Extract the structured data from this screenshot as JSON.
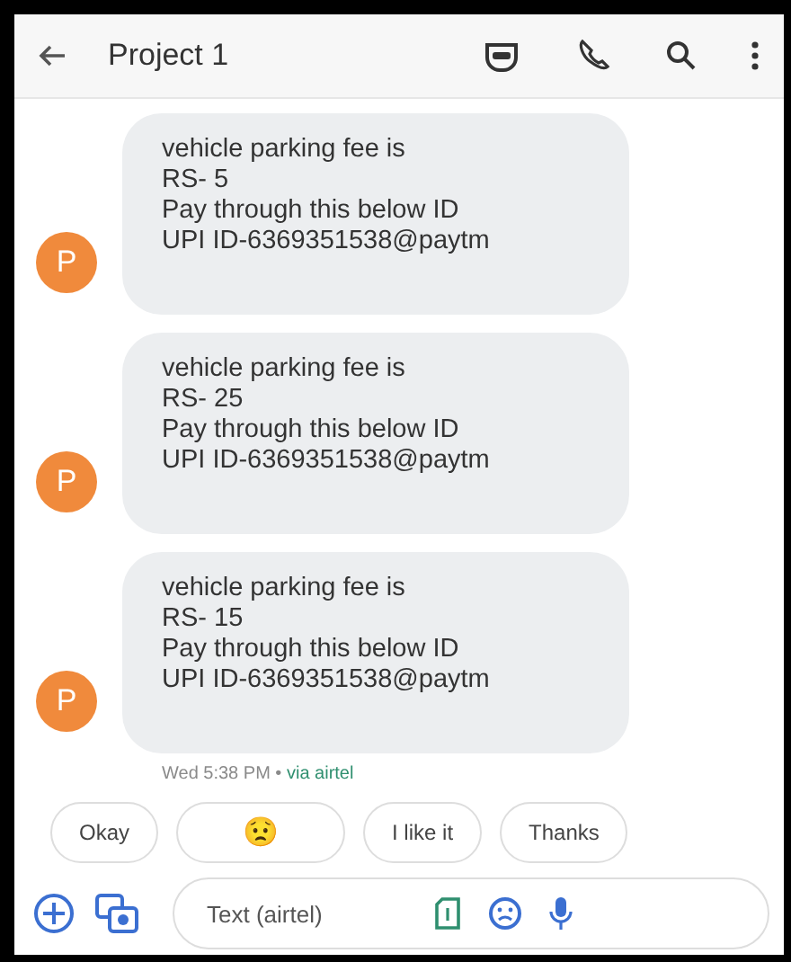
{
  "header": {
    "title": "Project 1"
  },
  "messages": [
    {
      "avatar": "P",
      "text": "vehicle parking fee is\nRS- 5\nPay through this below ID\nUPI ID-6369351538@paytm"
    },
    {
      "avatar": "P",
      "text": "vehicle parking fee is\nRS- 25\nPay through this below ID\nUPI ID-6369351538@paytm"
    },
    {
      "avatar": "P",
      "text": "vehicle parking fee is\nRS- 15\nPay through this below ID\nUPI ID-6369351538@paytm"
    }
  ],
  "timestamp": {
    "time": "Wed 5:38 PM •",
    "via": "via airtel"
  },
  "suggestions": [
    {
      "kind": "text",
      "label": "Okay"
    },
    {
      "kind": "emoji",
      "label": "😟"
    },
    {
      "kind": "text",
      "label": "I like it"
    },
    {
      "kind": "text",
      "label": "Thanks"
    }
  ],
  "composer": {
    "placeholder": "Text (airtel)"
  }
}
